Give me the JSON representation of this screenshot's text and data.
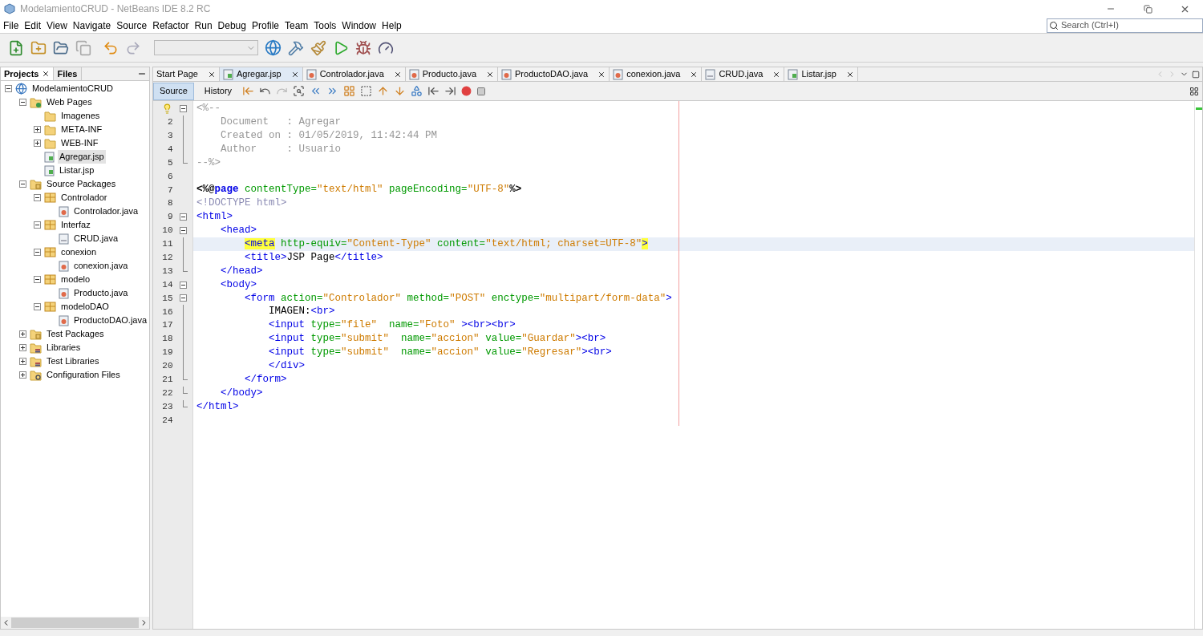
{
  "window": {
    "title": "ModelamientoCRUD - NetBeans IDE 8.2 RC"
  },
  "menu": [
    "File",
    "Edit",
    "View",
    "Navigate",
    "Source",
    "Refactor",
    "Run",
    "Debug",
    "Profile",
    "Team",
    "Tools",
    "Window",
    "Help"
  ],
  "search": {
    "placeholder": "Search (Ctrl+I)"
  },
  "panel_tabs": [
    {
      "label": "Projects",
      "selected": true,
      "closable": true
    },
    {
      "label": "Files",
      "selected": false,
      "closable": false
    }
  ],
  "tree": [
    {
      "label": "ModelamientoCRUD",
      "kind": "project",
      "expanded": true,
      "selected": false,
      "children": [
        {
          "label": "Web Pages",
          "kind": "webfolder",
          "expanded": true,
          "selected": false,
          "children": [
            {
              "label": "Imagenes",
              "kind": "folder",
              "selected": false
            },
            {
              "label": "META-INF",
              "kind": "folder",
              "expanded": false,
              "selected": false
            },
            {
              "label": "WEB-INF",
              "kind": "folder",
              "expanded": false,
              "selected": false
            },
            {
              "label": "Agregar.jsp",
              "kind": "jsp",
              "selected": true
            },
            {
              "label": "Listar.jsp",
              "kind": "jsp",
              "selected": false
            }
          ]
        },
        {
          "label": "Source Packages",
          "kind": "srcfolder",
          "expanded": true,
          "selected": false,
          "children": [
            {
              "label": "Controlador",
              "kind": "package",
              "expanded": true,
              "selected": false,
              "children": [
                {
                  "label": "Controlador.java",
                  "kind": "java",
                  "selected": false
                }
              ]
            },
            {
              "label": "Interfaz",
              "kind": "package",
              "expanded": true,
              "selected": false,
              "children": [
                {
                  "label": "CRUD.java",
                  "kind": "form",
                  "selected": false
                }
              ]
            },
            {
              "label": "conexion",
              "kind": "package",
              "expanded": true,
              "selected": false,
              "children": [
                {
                  "label": "conexion.java",
                  "kind": "java",
                  "selected": false
                }
              ]
            },
            {
              "label": "modelo",
              "kind": "package",
              "expanded": true,
              "selected": false,
              "children": [
                {
                  "label": "Producto.java",
                  "kind": "java",
                  "selected": false
                }
              ]
            },
            {
              "label": "modeloDAO",
              "kind": "package",
              "expanded": true,
              "selected": false,
              "children": [
                {
                  "label": "ProductoDAO.java",
                  "kind": "java",
                  "selected": false
                }
              ]
            }
          ]
        },
        {
          "label": "Test Packages",
          "kind": "srcfolder",
          "expanded": false,
          "selected": false
        },
        {
          "label": "Libraries",
          "kind": "library",
          "expanded": false,
          "selected": false
        },
        {
          "label": "Test Libraries",
          "kind": "library",
          "expanded": false,
          "selected": false
        },
        {
          "label": "Configuration Files",
          "kind": "config",
          "expanded": false,
          "selected": false
        }
      ]
    }
  ],
  "editor_tabs": [
    {
      "label": "Start Page",
      "kind": "page",
      "selected": false
    },
    {
      "label": "Agregar.jsp",
      "kind": "jsp",
      "selected": true
    },
    {
      "label": "Controlador.java",
      "kind": "java",
      "selected": false
    },
    {
      "label": "Producto.java",
      "kind": "java",
      "selected": false
    },
    {
      "label": "ProductoDAO.java",
      "kind": "java",
      "selected": false
    },
    {
      "label": "conexion.java",
      "kind": "java",
      "selected": false
    },
    {
      "label": "CRUD.java",
      "kind": "form",
      "selected": false
    },
    {
      "label": "Listar.jsp",
      "kind": "jsp",
      "selected": false
    }
  ],
  "view_tabs": [
    {
      "label": "Source",
      "selected": true
    },
    {
      "label": "History",
      "selected": false
    }
  ],
  "code": [
    {
      "hint": true,
      "fold_start": true,
      "fold_end": false,
      "current": false,
      "tokens": [
        {
          "t": "<%--",
          "kind": "comment"
        }
      ]
    },
    {
      "n": "2",
      "hint": false,
      "fold_start": false,
      "fold_end": false,
      "current": false,
      "tokens": [
        {
          "t": "    Document   : Agregar",
          "kind": "comment"
        }
      ]
    },
    {
      "n": "3",
      "hint": false,
      "fold_start": false,
      "fold_end": false,
      "current": false,
      "tokens": [
        {
          "t": "    Created on : 01/05/2019, 11:42:44 PM",
          "kind": "comment"
        }
      ]
    },
    {
      "n": "4",
      "hint": false,
      "fold_start": false,
      "fold_end": false,
      "current": false,
      "tokens": [
        {
          "t": "    Author     : Usuario",
          "kind": "comment"
        }
      ]
    },
    {
      "n": "5",
      "hint": false,
      "fold_start": false,
      "fold_end": true,
      "current": false,
      "tokens": [
        {
          "t": "--%>",
          "kind": "comment"
        }
      ]
    },
    {
      "n": "6",
      "hint": false,
      "fold_start": false,
      "fold_end": false,
      "current": false
    },
    {
      "n": "7",
      "hint": false,
      "fold_start": false,
      "fold_end": false,
      "current": false,
      "tokens": [
        {
          "t": "<%@",
          "kind": "delim"
        },
        {
          "t": "page",
          "kind": "directive"
        },
        {
          "t": " contentType=",
          "kind": "attr"
        },
        {
          "t": "\"text/html\"",
          "kind": "value"
        },
        {
          "t": " pageEncoding=",
          "kind": "attr"
        },
        {
          "t": "\"UTF-8\"",
          "kind": "value"
        },
        {
          "t": "%>",
          "kind": "delim"
        }
      ]
    },
    {
      "n": "8",
      "hint": false,
      "fold_start": false,
      "fold_end": false,
      "current": false,
      "tokens": [
        {
          "t": "<!DOCTYPE html>",
          "kind": "doctype"
        }
      ]
    },
    {
      "n": "9",
      "hint": false,
      "fold_start": true,
      "fold_end": false,
      "current": false,
      "tokens": [
        {
          "t": "<html>",
          "kind": "tag"
        }
      ]
    },
    {
      "n": "10",
      "hint": false,
      "fold_start": true,
      "fold_end": false,
      "current": false,
      "tokens": [
        {
          "t": "    <head>",
          "kind": "tag"
        }
      ]
    },
    {
      "n": "11",
      "hint": false,
      "fold_start": false,
      "fold_end": false,
      "current": true,
      "tokens": [
        {
          "t": "        <meta",
          "kind": "tag-match"
        },
        {
          "t": " http-equiv=",
          "kind": "attr"
        },
        {
          "t": "\"Content-Type\"",
          "kind": "value"
        },
        {
          "t": " content=",
          "kind": "attr"
        },
        {
          "t": "\"text/html; charset=UTF-8\"",
          "kind": "value"
        },
        {
          "t": ">",
          "kind": "tag-match"
        }
      ]
    },
    {
      "n": "12",
      "hint": false,
      "fold_start": false,
      "fold_end": false,
      "current": false,
      "tokens": [
        {
          "t": "        <title>",
          "kind": "tag"
        },
        {
          "t": "JSP Page",
          "kind": "text"
        },
        {
          "t": "</title>",
          "kind": "tag"
        }
      ]
    },
    {
      "n": "13",
      "hint": false,
      "fold_start": false,
      "fold_end": true,
      "current": false,
      "tokens": [
        {
          "t": "    </head>",
          "kind": "tag"
        }
      ]
    },
    {
      "n": "14",
      "hint": false,
      "fold_start": true,
      "fold_end": false,
      "current": false,
      "tokens": [
        {
          "t": "    <body>",
          "kind": "tag"
        }
      ]
    },
    {
      "n": "15",
      "hint": false,
      "fold_start": true,
      "fold_end": false,
      "current": false,
      "tokens": [
        {
          "t": "        <form",
          "kind": "tag"
        },
        {
          "t": " action=",
          "kind": "attr"
        },
        {
          "t": "\"Controlador\"",
          "kind": "value"
        },
        {
          "t": " method=",
          "kind": "attr"
        },
        {
          "t": "\"POST\"",
          "kind": "value"
        },
        {
          "t": " enctype=",
          "kind": "attr"
        },
        {
          "t": "\"multipart/form-data\"",
          "kind": "value"
        },
        {
          "t": ">",
          "kind": "tag"
        }
      ]
    },
    {
      "n": "16",
      "hint": false,
      "fold_start": false,
      "fold_end": false,
      "current": false,
      "tokens": [
        {
          "t": "            IMAGEN:",
          "kind": "text"
        },
        {
          "t": "<br>",
          "kind": "tag"
        }
      ]
    },
    {
      "n": "17",
      "hint": false,
      "fold_start": false,
      "fold_end": false,
      "current": false,
      "tokens": [
        {
          "t": "            <input",
          "kind": "tag"
        },
        {
          "t": " type=",
          "kind": "attr"
        },
        {
          "t": "\"file\"",
          "kind": "value"
        },
        {
          "t": "  name=",
          "kind": "attr"
        },
        {
          "t": "\"Foto\"",
          "kind": "value"
        },
        {
          "t": " ><br><br>",
          "kind": "tag"
        }
      ]
    },
    {
      "n": "18",
      "hint": false,
      "fold_start": false,
      "fold_end": false,
      "current": false,
      "tokens": [
        {
          "t": "            <input",
          "kind": "tag"
        },
        {
          "t": " type=",
          "kind": "attr"
        },
        {
          "t": "\"submit\"",
          "kind": "value"
        },
        {
          "t": "  name=",
          "kind": "attr"
        },
        {
          "t": "\"accion\"",
          "kind": "value"
        },
        {
          "t": " value=",
          "kind": "attr"
        },
        {
          "t": "\"Guardar\"",
          "kind": "value"
        },
        {
          "t": "><br>",
          "kind": "tag"
        }
      ]
    },
    {
      "n": "19",
      "hint": false,
      "fold_start": false,
      "fold_end": false,
      "current": false,
      "tokens": [
        {
          "t": "            <input",
          "kind": "tag"
        },
        {
          "t": " type=",
          "kind": "attr"
        },
        {
          "t": "\"submit\"",
          "kind": "value"
        },
        {
          "t": "  name=",
          "kind": "attr"
        },
        {
          "t": "\"accion\"",
          "kind": "value"
        },
        {
          "t": " value=",
          "kind": "attr"
        },
        {
          "t": "\"Regresar\"",
          "kind": "value"
        },
        {
          "t": "><br>",
          "kind": "tag"
        }
      ]
    },
    {
      "n": "20",
      "hint": false,
      "fold_start": false,
      "fold_end": false,
      "current": false,
      "tokens": [
        {
          "t": "            </div>",
          "kind": "tag"
        }
      ]
    },
    {
      "n": "21",
      "hint": false,
      "fold_start": false,
      "fold_end": true,
      "current": false,
      "tokens": [
        {
          "t": "        </form>",
          "kind": "tag"
        }
      ]
    },
    {
      "n": "22",
      "hint": false,
      "fold_start": false,
      "fold_end": true,
      "current": false,
      "tokens": [
        {
          "t": "    </body>",
          "kind": "tag"
        }
      ]
    },
    {
      "n": "23",
      "hint": false,
      "fold_start": false,
      "fold_end": true,
      "current": false,
      "tokens": [
        {
          "t": "</html>",
          "kind": "tag"
        }
      ]
    },
    {
      "n": "24",
      "hint": false,
      "fold_start": false,
      "fold_end": false,
      "current": false
    }
  ]
}
